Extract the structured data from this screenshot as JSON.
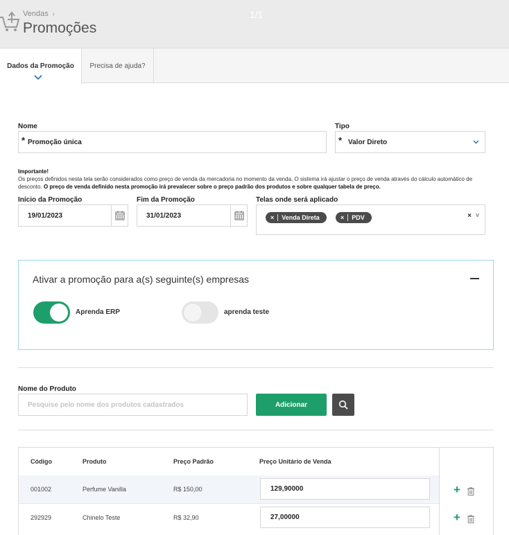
{
  "header": {
    "breadcrumb": "Vendas",
    "title": "Promoções",
    "page_counter": "1/1"
  },
  "tabs": [
    {
      "label": "Dados da Promoção",
      "active": true
    },
    {
      "label": "Precisa de ajuda?",
      "active": false
    }
  ],
  "form": {
    "name_label": "Nome",
    "name_value": "Promoção única",
    "type_label": "Tipo",
    "type_value": "Valor Direto",
    "required_mark": "*",
    "notice_title": "Importante!",
    "notice_text": "Os preços definidos nesta tela serão considerados como preço de venda da mercadoria no momento da venda. O sistema irá ajustar o preço de venda através do cálculo automático de desconto.",
    "notice_bold": "O preço de venda definido nesta promoção irá prevalecer sobre o preço padrão dos produtos e sobre qualquer tabela de preço.",
    "start_label": "Início da Promoção",
    "start_value": "19/01/2023",
    "end_label": "Fim da Promoção",
    "end_value": "31/01/2023",
    "screens_label": "Telas onde será aplicado",
    "screens": [
      "Venda Direta",
      "PDV"
    ],
    "chip_remove": "×",
    "clear_all": "×",
    "caret": "v"
  },
  "companies": {
    "title": "Ativar a promoção para a(s) seguinte(s) empresas",
    "items": [
      {
        "name": "Aprenda ERP",
        "enabled": true
      },
      {
        "name": "aprenda teste",
        "enabled": false
      }
    ]
  },
  "product_search": {
    "label": "Nome do Produto",
    "placeholder": "Pesquise pelo nome dos produtos cadastrados",
    "add_label": "Adicionar"
  },
  "table": {
    "headers": [
      "Código",
      "Produto",
      "Preço Padrão",
      "Preço Unitário de Venda"
    ],
    "rows": [
      {
        "code": "001002",
        "product": "Perfume Vanilla",
        "default_price": "R$ 150,00",
        "unit_price": "129,90000"
      },
      {
        "code": "292929",
        "product": "Chinelo Teste",
        "default_price": "R$ 32,90",
        "unit_price": "27,00000"
      }
    ]
  },
  "colors": {
    "accent_green": "#1e9e6a",
    "dark_gray": "#4b4b4b",
    "panel_border": "#9cd7dd"
  }
}
